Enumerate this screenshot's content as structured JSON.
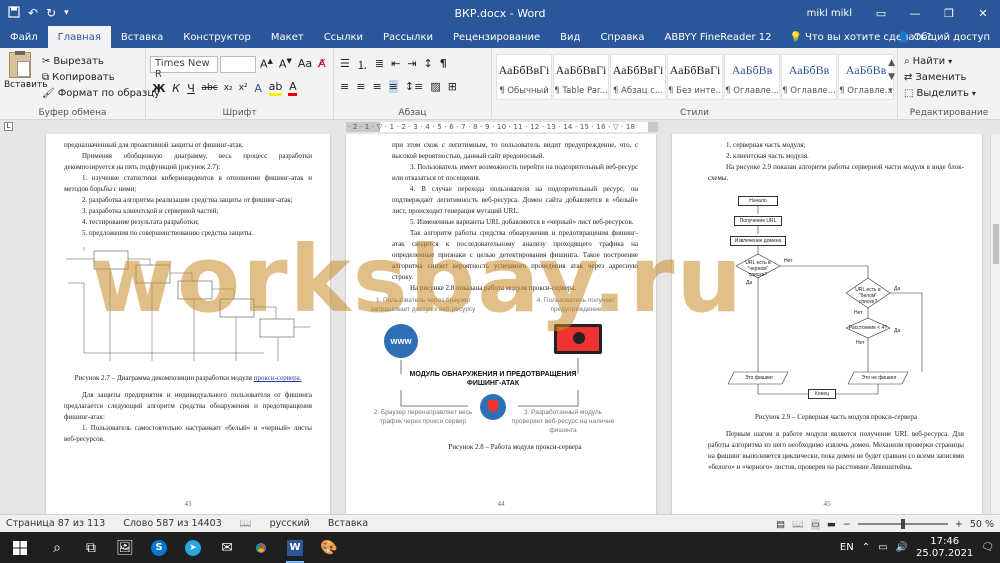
{
  "window": {
    "title": "ВКР.docx - Word",
    "user": "mikl mikl",
    "colors": {
      "word_blue": "#2b579a",
      "ribbon_bg": "#f3f3f3",
      "watermark": "#c88a28"
    }
  },
  "quick_access": {
    "save_icon": "save-icon",
    "undo_icon": "undo-icon",
    "redo_icon": "redo-icon"
  },
  "menu": {
    "tabs": [
      "Файл",
      "Главная",
      "Вставка",
      "Конструктор",
      "Макет",
      "Ссылки",
      "Рассылки",
      "Рецензирование",
      "Вид",
      "Справка",
      "ABBYY FineReader 12"
    ],
    "active_tab": "Главная",
    "tell_me": "Что вы хотите сделать?",
    "share": "Общий доступ"
  },
  "ribbon": {
    "clipboard": {
      "label": "Буфер обмена",
      "paste": "Вставить",
      "cut": "Вырезать",
      "copy": "Копировать",
      "format_painter": "Формат по образцу"
    },
    "font": {
      "label": "Шрифт",
      "font_name": "Times New R",
      "font_size": "",
      "bold": "Ж",
      "italic": "К",
      "underline": "Ч",
      "strike": "abc",
      "subscript": "x₂",
      "superscript": "x²"
    },
    "paragraph": {
      "label": "Абзац"
    },
    "styles": {
      "label": "Стили",
      "items": [
        {
          "sample": "АаБбВвГі",
          "name": "¶ Обычный"
        },
        {
          "sample": "АаБбВвГі",
          "name": "¶ Table Par..."
        },
        {
          "sample": "АаБбВвГі",
          "name": "¶ Абзац с..."
        },
        {
          "sample": "АаБбВвГі",
          "name": "¶ Без инте..."
        },
        {
          "sample": "АаБбВв",
          "name": "¶ Оглавле..."
        },
        {
          "sample": "АаБбВв",
          "name": "¶ Оглавле..."
        },
        {
          "sample": "АаБбВв",
          "name": "¶ Оглавле..."
        }
      ]
    },
    "editing": {
      "label": "Редактирование",
      "find": "Найти",
      "replace": "Заменить",
      "select": "Выделить"
    }
  },
  "ruler": {
    "ticks": "· 2 · 1 · ▽ · 1 · 2 · 3 · 4 · 5 · 6 · 7 · 8 · 9 · 10 · 11 · 12 · 13 · 14 · 15 · 16 · ▽ · 18",
    "corner": "L"
  },
  "pages": {
    "left": {
      "number": "43",
      "p1": "предназначенный для проактивной защиты от фишинг-атак.",
      "p2": "Применяя обобщенную диаграмму, весь процесс разработки декомпозируется на пять подфункций (рисунок 2.7):",
      "list": [
        "1. изучение статистики киберинцидентов в отношении фишинг-атак и методов борьбы с ними;",
        "2. разработка алгоритма реализации средства защиты от фишинг-атак;",
        "3. разработка клиентской и серверной частей;",
        "4. тестирование результата разработки;",
        "5. предложения по совершенствованию средства защиты."
      ],
      "caption_prefix": "Рисунок 2.7 – Диаграмма декомпозиции разработки модуля",
      "caption_link": "прокси-сервера.",
      "p3": "Для защиты предприятия и индивидуального пользователя от фишинга предлагается следующий алгоритм средства обнаружения и предотвращения фишинг-атак:",
      "p4": "1. Пользователь самостоятельно настраивает «белый» и «черный» листы веб-ресурсов."
    },
    "middle": {
      "number": "44",
      "p1": "при этом схож с легитимным, то пользователь видит предупреждение, что, с высокой вероятностью, данный сайт вредоносный.",
      "p2": "3. Пользователь имеет возможность перейти на подозрительный веб-ресурс или отказаться от посещения.",
      "p3": "4. В случае перехода пользователя на подозрительный ресурс, он подтверждает легитимность веб-ресурса. Домен сайта добавляется в «белый» лист, происходит генерация мутаций URL.",
      "p4": "5. Измененные варианты URL добавляются в «черный» лист веб-ресурсов.",
      "p5": "Так алгоритм работы средства обнаружения и предотвращения фишинг-атак сводится к последовательному анализу проходящего трафика на определенные признаки с целью детектирования фишинга. Такое построение алгоритма снизит вероятность успешного проведения атак через адресную строку.",
      "p6": "На рисунке 2.8 показана работа модуля прокси-сервера.",
      "fig": {
        "step1": "1. Пользователь через браузер запрашивает доступ к веб-ресурсу",
        "step4": "4. Пользователь получает предупреждение",
        "center": "МОДУЛЬ ОБНАРУЖЕНИЯ И ПРЕДОТВРАЩЕНИЯ ФИШИНГ-АТАК",
        "step2": "2. Браузер перенаправляет весь трафик через прокси сервер",
        "step3": "3. Разработанный модуль проверяет веб-ресурс на наличие фишинга",
        "www": "www"
      },
      "caption": "Рисунок 2.8 – Работа модуля прокси-сервера"
    },
    "right": {
      "number": "45",
      "list": [
        "1. серверная часть модуля;",
        "2. клиентская часть модуля."
      ],
      "p1": "На рисунке 2.9 показан алгоритм работы серверной части модуля в виде блок-схемы.",
      "flow": {
        "start": "Начало",
        "get_url": "Получение URL",
        "extract": "Извлечение домена",
        "check_black": "URL есть в \"черном\" списке?",
        "yes": "Да",
        "no": "Нет",
        "check_white": "URL есть в \"белом\" списке?",
        "distance": "Расстояние < 4?",
        "phish": "Это фишинг",
        "not_phish": "Это не фишинг",
        "end": "Конец"
      },
      "caption": "Рисунок 2.9 – Серверная часть модуля прокси-сервера",
      "p2": "Первым шагом в работе модуля является получение URL веб-ресурса. Для работы алгоритма из него необходимо извлечь домен. Механизм проверки страницы на фишинг выполняется циклически, пока домен не будет сравнен со всеми записями «белого» и «черного» листов, проверен на расстояние Левенштейна."
    }
  },
  "watermark": "worksbay.ru",
  "status": {
    "page": "Страница 87 из 113",
    "words": "Слово 587 из 14403",
    "language": "русский",
    "mode": "Вставка",
    "zoom": "50 %",
    "zoom_minus": "−",
    "zoom_plus": "+",
    "zoom_fraction": 0.5
  },
  "taskbar": {
    "icons": [
      "windows-start-icon",
      "search-icon",
      "task-view-icon",
      "photos-icon",
      "skype-icon",
      "telegram-icon",
      "mail-icon",
      "chrome-icon",
      "word-icon",
      "paint-icon"
    ],
    "lang": "EN",
    "time": "17:46",
    "date": "25.07.2021"
  }
}
